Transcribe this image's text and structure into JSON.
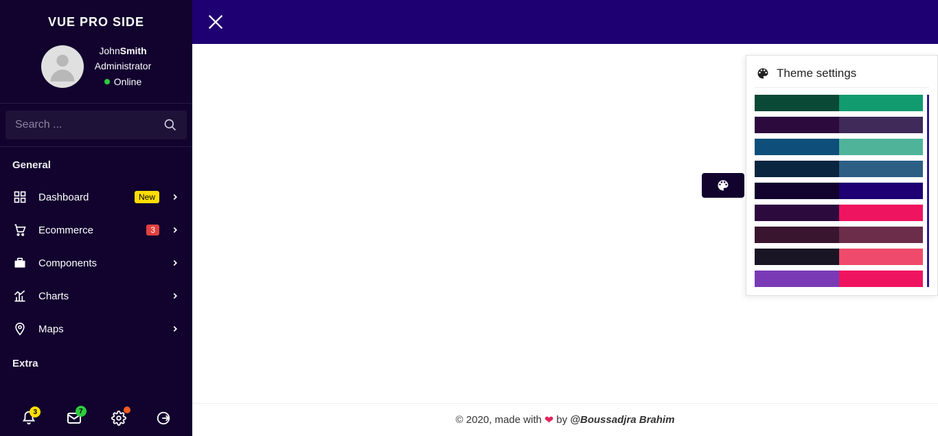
{
  "logo": "VUE PRO SIDE",
  "user": {
    "first": "John",
    "last": "Smith",
    "role": "Administrator",
    "status": "Online"
  },
  "search": {
    "placeholder": "Search ..."
  },
  "sections": {
    "general": "General",
    "extra": "Extra"
  },
  "menu": {
    "dashboard": {
      "label": "Dashboard",
      "badge": "New"
    },
    "ecommerce": {
      "label": "Ecommerce",
      "count": "3"
    },
    "components": {
      "label": "Components"
    },
    "charts": {
      "label": "Charts"
    },
    "maps": {
      "label": "Maps"
    }
  },
  "footer_icons": {
    "bell_count": "3",
    "mail_count": "7"
  },
  "theme": {
    "title": "Theme settings",
    "options": [
      {
        "c1": "#0a4935",
        "c2": "#129b6f"
      },
      {
        "c1": "#2d0a3e",
        "c2": "#3f2a5a"
      },
      {
        "c1": "#0d4f7a",
        "c2": "#4fb39a"
      },
      {
        "c1": "#0a2540",
        "c2": "#2d5f85"
      },
      {
        "c1": "#11022e",
        "c2": "#1f0072"
      },
      {
        "c1": "#2d0a3e",
        "c2": "#ef1460"
      },
      {
        "c1": "#3a1530",
        "c2": "#6b2d4a"
      },
      {
        "c1": "#1a1525",
        "c2": "#ef4a6b"
      },
      {
        "c1": "#7a3ab5",
        "c2": "#ef1460"
      }
    ]
  },
  "page_footer": {
    "copyright": "© 2020, made with",
    "by": "by",
    "credit": "@Boussadjra Brahim"
  }
}
